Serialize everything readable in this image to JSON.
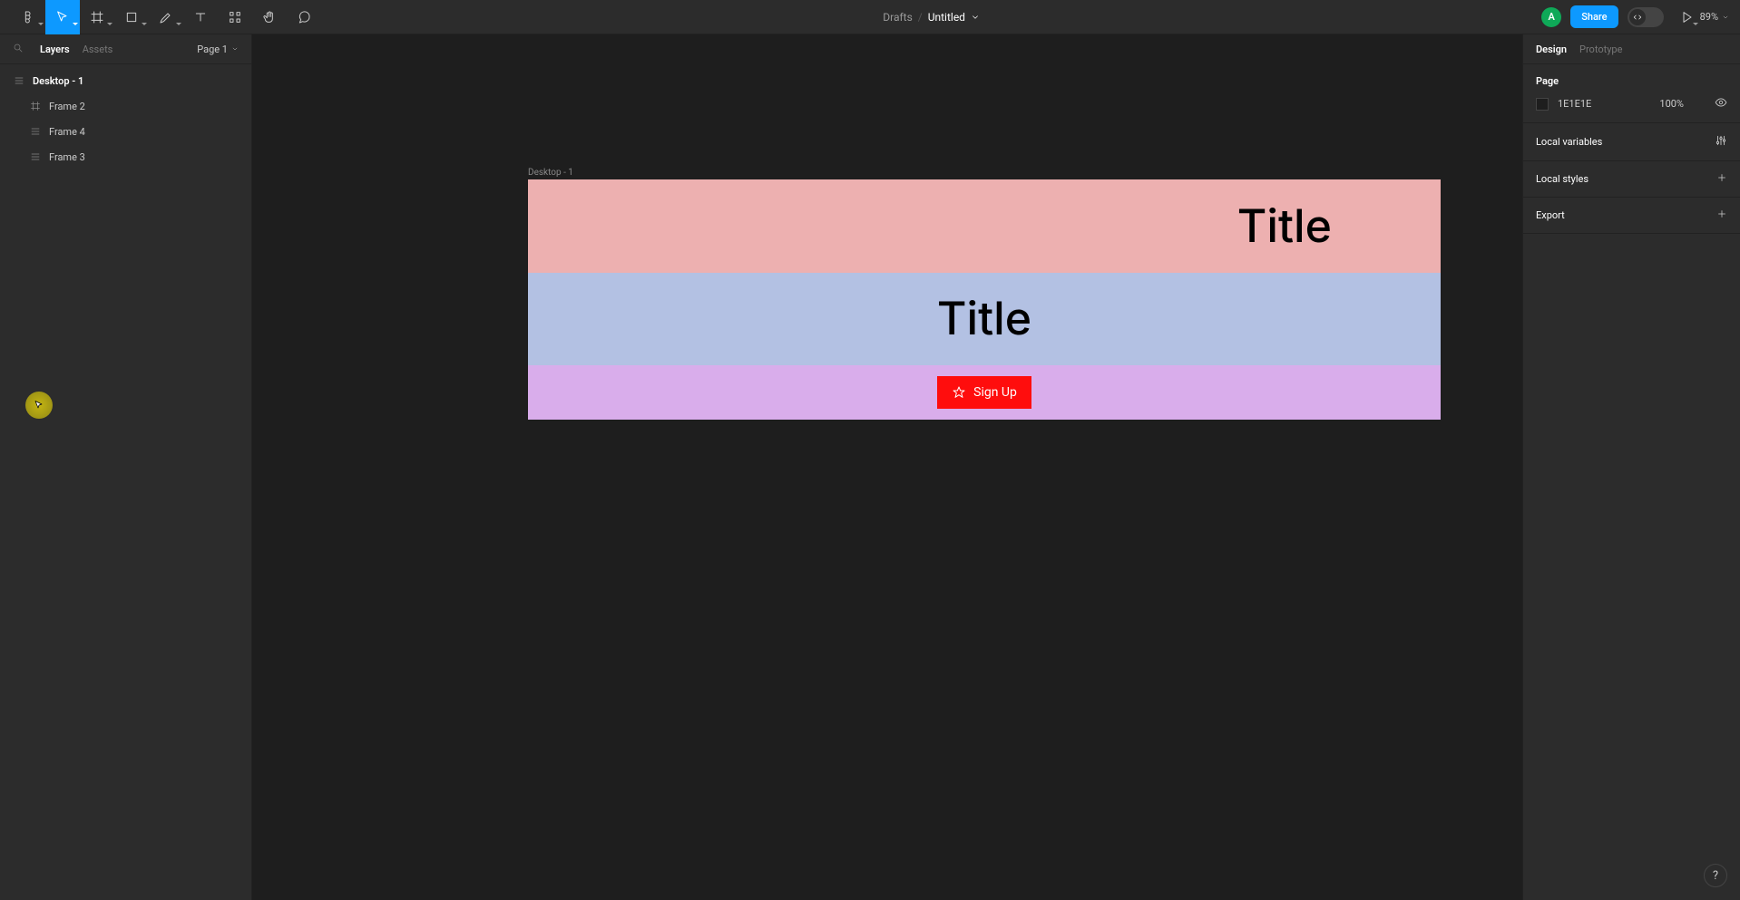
{
  "toolbar": {
    "center": {
      "drafts": "Drafts",
      "file": "Untitled"
    },
    "avatar_initial": "A",
    "share_label": "Share",
    "zoom": "89%"
  },
  "left_panel": {
    "tabs": {
      "layers": "Layers",
      "assets": "Assets"
    },
    "page_selector": "Page 1",
    "tree": {
      "root": "Desktop - 1",
      "children": [
        "Frame 2",
        "Frame 4",
        "Frame 3"
      ]
    }
  },
  "right_panel": {
    "tabs": {
      "design": "Design",
      "prototype": "Prototype"
    },
    "page_section": {
      "title": "Page",
      "color_hex": "1E1E1E",
      "opacity": "100%"
    },
    "local_variables": "Local variables",
    "local_styles": "Local styles",
    "export": "Export"
  },
  "canvas": {
    "frame_label": "Desktop - 1",
    "band1_text": "Title",
    "band2_text": "Title",
    "signup_label": "Sign Up"
  },
  "help": "?"
}
